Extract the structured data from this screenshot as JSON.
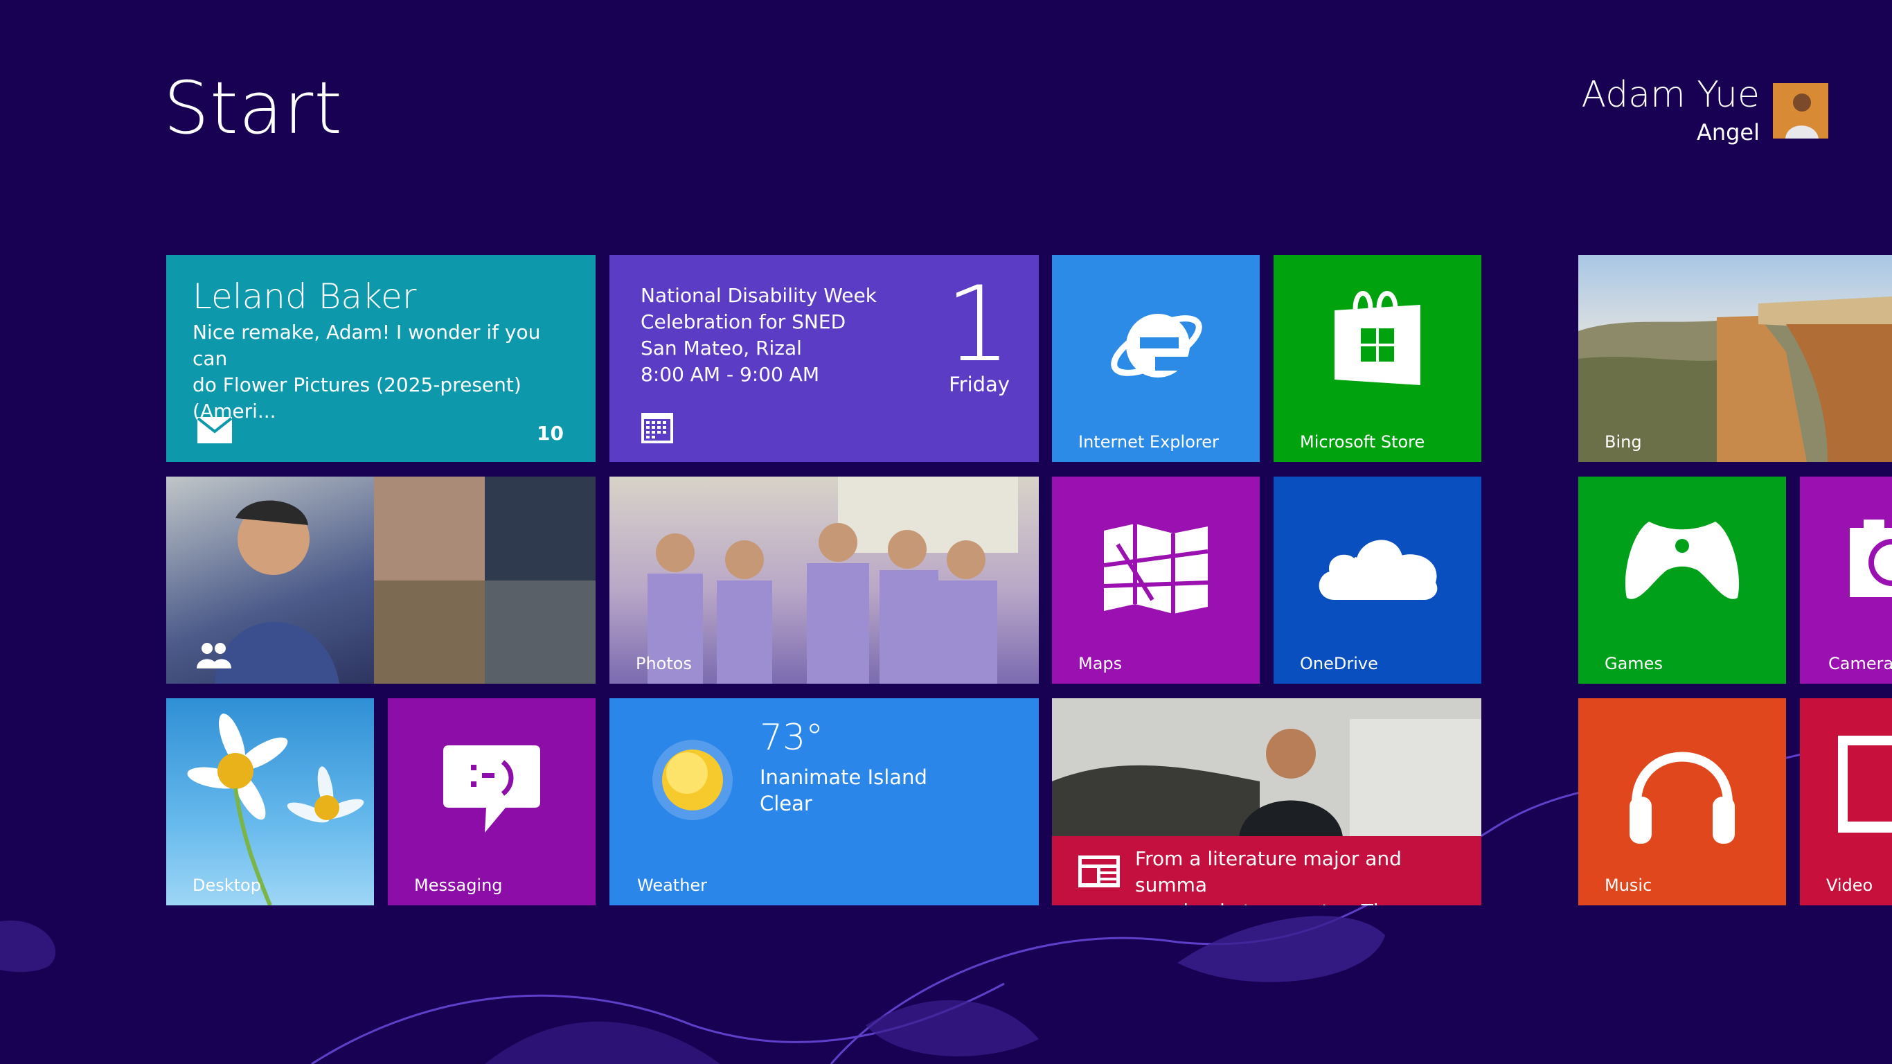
{
  "header": {
    "title": "Start",
    "user_name": "Adam Yue",
    "user_subtitle": "Angel"
  },
  "tiles": {
    "mail": {
      "sender": "Leland Baker",
      "message_line1": "Nice remake, Adam! I wonder if you can",
      "message_line2": "do Flower Pictures (2025-present) (Ameri...",
      "count": "10",
      "color": "#0e98ab"
    },
    "calendar": {
      "line1": "National Disability Week",
      "line2": "Celebration for SNED",
      "line3": "San Mateo, Rizal",
      "line4": "8:00 AM - 9:00 AM",
      "day": "1",
      "weekday": "Friday",
      "color": "#5b3cc4"
    },
    "ie": {
      "label": "Internet Explorer",
      "color": "#2b8be6"
    },
    "store": {
      "label": "Microsoft Store",
      "color": "#00a20e"
    },
    "bing": {
      "label": "Bing"
    },
    "people": {
      "color": "#4a4a4a"
    },
    "photos": {
      "label": "Photos"
    },
    "maps": {
      "label": "Maps",
      "color": "#9b10b0"
    },
    "onedrive": {
      "label": "OneDrive",
      "color": "#094fc0"
    },
    "games": {
      "label": "Games",
      "color": "#00a01a"
    },
    "camera": {
      "label": "Camera",
      "color": "#9b10b0"
    },
    "desktop": {
      "label": "Desktop"
    },
    "messaging": {
      "label": "Messaging",
      "color": "#8d0da8"
    },
    "weather": {
      "temp": "73°",
      "location": "Inanimate Island",
      "condition": "Clear",
      "label": "Weather",
      "color": "#2a86e8"
    },
    "news": {
      "headline_line1": "From a literature major and summa",
      "headline_line2": "cum laude to an actor: The many fa...",
      "caption_color": "#c4103e"
    },
    "music": {
      "label": "Music",
      "color": "#e0471c"
    },
    "video": {
      "label": "Video",
      "color": "#c8103c"
    }
  },
  "icons": [
    "mail-icon",
    "calendar-icon",
    "ie-icon",
    "store-icon",
    "people-icon",
    "maps-icon",
    "onedrive-icon",
    "games-icon",
    "camera-icon",
    "messaging-icon",
    "sun-icon",
    "news-icon",
    "headphones-icon",
    "video-icon"
  ],
  "colors": {
    "background": "#180052"
  }
}
